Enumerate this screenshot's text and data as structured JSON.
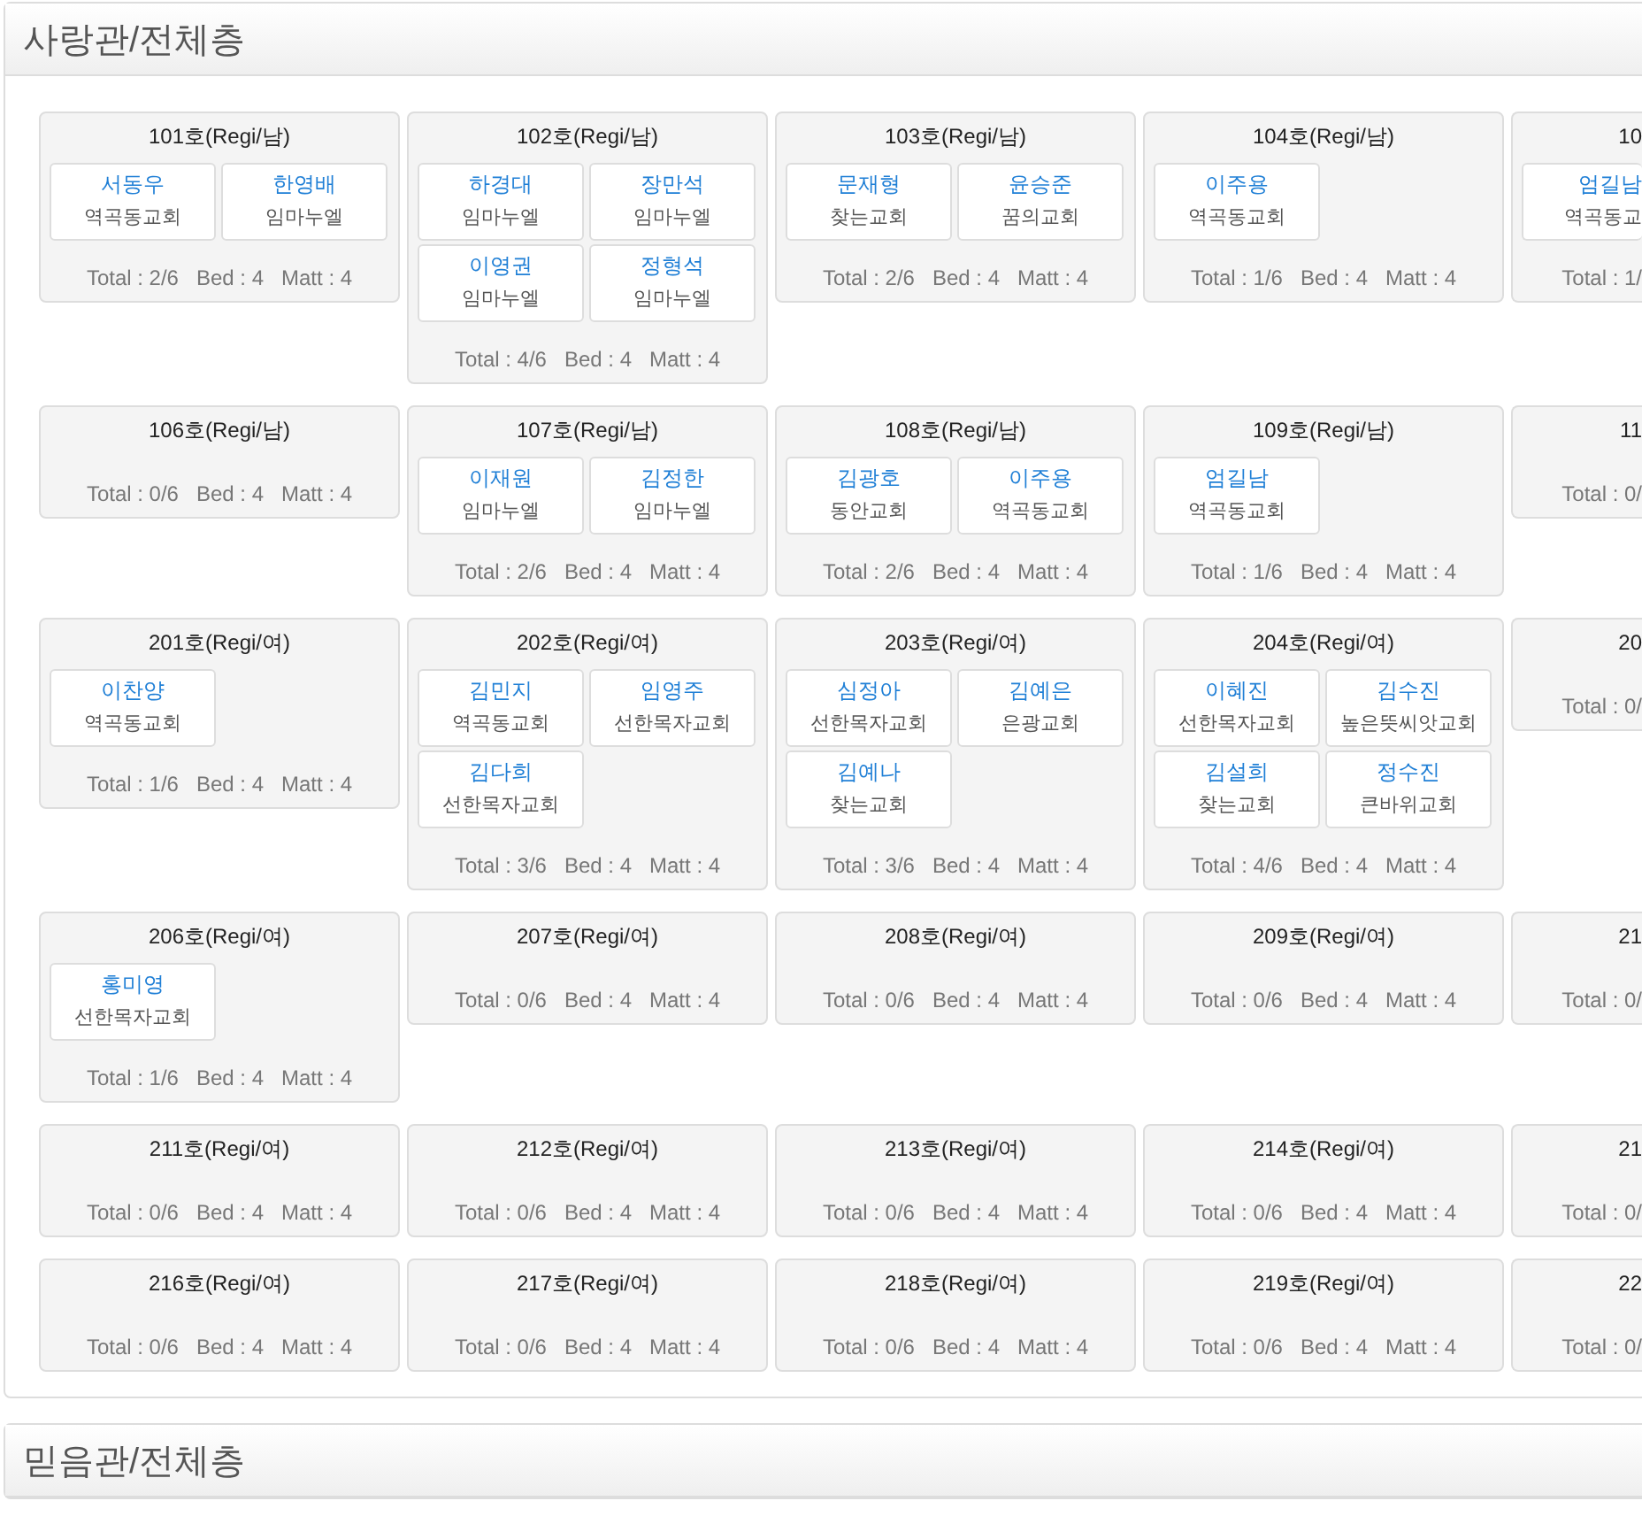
{
  "sections": [
    {
      "title": "사랑관/전체층",
      "rows": [
        [
          {
            "room": "101호(Regi/남)",
            "occupants": [
              {
                "name": "서동우",
                "church": "역곡동교회"
              },
              {
                "name": "한영배",
                "church": "임마누엘"
              }
            ],
            "total": "Total : 2/6",
            "bed": "Bed : 4",
            "matt": "Matt : 4"
          },
          {
            "room": "102호(Regi/남)",
            "occupants": [
              {
                "name": "하경대",
                "church": "임마누엘"
              },
              {
                "name": "장만석",
                "church": "임마누엘"
              },
              {
                "name": "이영권",
                "church": "임마누엘"
              },
              {
                "name": "정형석",
                "church": "임마누엘"
              }
            ],
            "total": "Total : 4/6",
            "bed": "Bed : 4",
            "matt": "Matt : 4"
          },
          {
            "room": "103호(Regi/남)",
            "occupants": [
              {
                "name": "문재형",
                "church": "찾는교회"
              },
              {
                "name": "윤승준",
                "church": "꿈의교회"
              }
            ],
            "total": "Total : 2/6",
            "bed": "Bed : 4",
            "matt": "Matt : 4"
          },
          {
            "room": "104호(Regi/남)",
            "occupants": [
              {
                "name": "이주용",
                "church": "역곡동교회"
              }
            ],
            "total": "Total : 1/6",
            "bed": "Bed : 4",
            "matt": "Matt : 4"
          },
          {
            "room": "10",
            "occupants": [
              {
                "name": "엄길남",
                "church": "역곡동교"
              }
            ],
            "total": "Total : 1/"
          }
        ],
        [
          {
            "room": "106호(Regi/남)",
            "total": "Total : 0/6",
            "bed": "Bed : 4",
            "matt": "Matt : 4"
          },
          {
            "room": "107호(Regi/남)",
            "occupants": [
              {
                "name": "이재원",
                "church": "임마누엘"
              },
              {
                "name": "김정한",
                "church": "임마누엘"
              }
            ],
            "total": "Total : 2/6",
            "bed": "Bed : 4",
            "matt": "Matt : 4"
          },
          {
            "room": "108호(Regi/남)",
            "occupants": [
              {
                "name": "김광호",
                "church": "동안교회"
              },
              {
                "name": "이주용",
                "church": "역곡동교회"
              }
            ],
            "total": "Total : 2/6",
            "bed": "Bed : 4",
            "matt": "Matt : 4"
          },
          {
            "room": "109호(Regi/남)",
            "occupants": [
              {
                "name": "엄길남",
                "church": "역곡동교회"
              }
            ],
            "total": "Total : 1/6",
            "bed": "Bed : 4",
            "matt": "Matt : 4"
          },
          {
            "room": "11",
            "total": "Total : 0/"
          }
        ],
        [
          {
            "room": "201호(Regi/여)",
            "occupants": [
              {
                "name": "이찬양",
                "church": "역곡동교회"
              }
            ],
            "total": "Total : 1/6",
            "bed": "Bed : 4",
            "matt": "Matt : 4"
          },
          {
            "room": "202호(Regi/여)",
            "occupants": [
              {
                "name": "김민지",
                "church": "역곡동교회"
              },
              {
                "name": "임영주",
                "church": "선한목자교회"
              },
              {
                "name": "김다희",
                "church": "선한목자교회"
              }
            ],
            "total": "Total : 3/6",
            "bed": "Bed : 4",
            "matt": "Matt : 4"
          },
          {
            "room": "203호(Regi/여)",
            "occupants": [
              {
                "name": "심정아",
                "church": "선한목자교회"
              },
              {
                "name": "김예은",
                "church": "은광교회"
              },
              {
                "name": "김예나",
                "church": "찾는교회"
              }
            ],
            "total": "Total : 3/6",
            "bed": "Bed : 4",
            "matt": "Matt : 4"
          },
          {
            "room": "204호(Regi/여)",
            "occupants": [
              {
                "name": "이혜진",
                "church": "선한목자교회"
              },
              {
                "name": "김수진",
                "church": "높은뜻씨앗교회"
              },
              {
                "name": "김설희",
                "church": "찾는교회"
              },
              {
                "name": "정수진",
                "church": "큰바위교회"
              }
            ],
            "total": "Total : 4/6",
            "bed": "Bed : 4",
            "matt": "Matt : 4"
          },
          {
            "room": "20",
            "total": "Total : 0/"
          }
        ],
        [
          {
            "room": "206호(Regi/여)",
            "occupants": [
              {
                "name": "홍미영",
                "church": "선한목자교회"
              }
            ],
            "total": "Total : 1/6",
            "bed": "Bed : 4",
            "matt": "Matt : 4"
          },
          {
            "room": "207호(Regi/여)",
            "total": "Total : 0/6",
            "bed": "Bed : 4",
            "matt": "Matt : 4"
          },
          {
            "room": "208호(Regi/여)",
            "total": "Total : 0/6",
            "bed": "Bed : 4",
            "matt": "Matt : 4"
          },
          {
            "room": "209호(Regi/여)",
            "total": "Total : 0/6",
            "bed": "Bed : 4",
            "matt": "Matt : 4"
          },
          {
            "room": "21",
            "total": "Total : 0/"
          }
        ],
        [
          {
            "room": "211호(Regi/여)",
            "total": "Total : 0/6",
            "bed": "Bed : 4",
            "matt": "Matt : 4"
          },
          {
            "room": "212호(Regi/여)",
            "total": "Total : 0/6",
            "bed": "Bed : 4",
            "matt": "Matt : 4"
          },
          {
            "room": "213호(Regi/여)",
            "total": "Total : 0/6",
            "bed": "Bed : 4",
            "matt": "Matt : 4"
          },
          {
            "room": "214호(Regi/여)",
            "total": "Total : 0/6",
            "bed": "Bed : 4",
            "matt": "Matt : 4"
          },
          {
            "room": "21",
            "total": "Total : 0/"
          }
        ],
        [
          {
            "room": "216호(Regi/여)",
            "total": "Total : 0/6",
            "bed": "Bed : 4",
            "matt": "Matt : 4"
          },
          {
            "room": "217호(Regi/여)",
            "total": "Total : 0/6",
            "bed": "Bed : 4",
            "matt": "Matt : 4"
          },
          {
            "room": "218호(Regi/여)",
            "total": "Total : 0/6",
            "bed": "Bed : 4",
            "matt": "Matt : 4"
          },
          {
            "room": "219호(Regi/여)",
            "total": "Total : 0/6",
            "bed": "Bed : 4",
            "matt": "Matt : 4"
          },
          {
            "room": "22",
            "total": "Total : 0/"
          }
        ]
      ]
    },
    {
      "title": "믿음관/전체층"
    }
  ]
}
